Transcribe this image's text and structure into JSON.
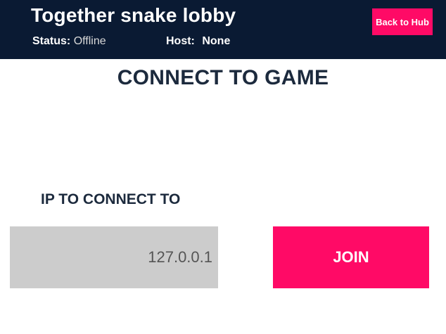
{
  "header": {
    "title": "Together snake lobby",
    "status_label": "Status:",
    "status_value": "Offline",
    "host_label": "Host:",
    "host_value": "None",
    "back_button_label": "Back to Hub"
  },
  "main": {
    "title": "CONNECT TO GAME",
    "ip_label": "IP TO CONNECT TO",
    "ip_value": "127.0.0.1",
    "join_button_label": "JOIN"
  },
  "colors": {
    "header_bg": "#0a1a33",
    "accent": "#ff0a66",
    "input_bg": "#cccccc",
    "heading_text": "#1c2a3d"
  }
}
